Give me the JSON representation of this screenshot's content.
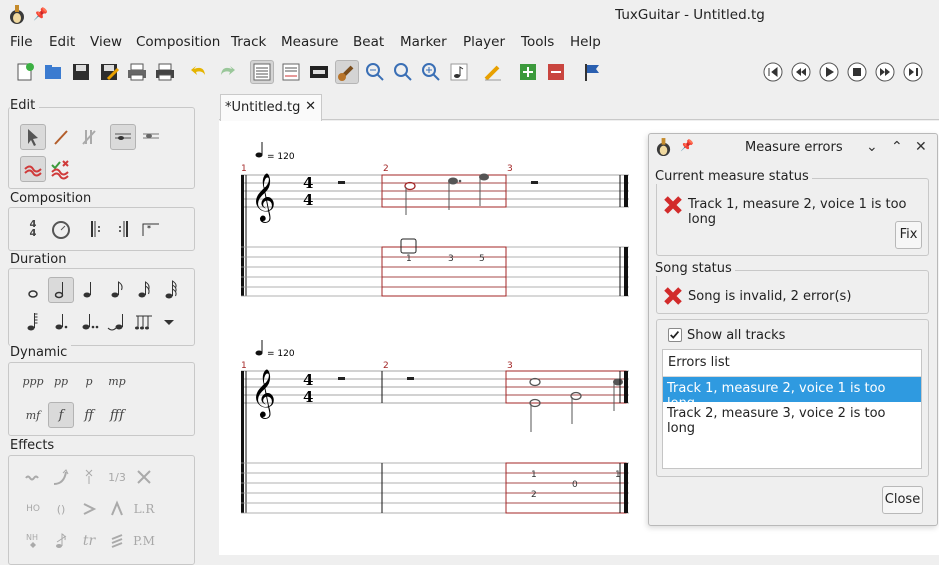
{
  "window": {
    "title": "TuxGuitar - Untitled.tg"
  },
  "menu": [
    "File",
    "Edit",
    "View",
    "Composition",
    "Track",
    "Measure",
    "Beat",
    "Marker",
    "Player",
    "Tools",
    "Help"
  ],
  "toolbar_icons": [
    "new-file-icon",
    "open-file-icon",
    "save-icon",
    "save-as-icon",
    "print-preview-icon",
    "print-icon",
    "undo-icon",
    "redo-icon",
    "score-view-icon",
    "tab-view-icon",
    "page-layout-icon",
    "guitar-fretboard-icon",
    "zoom-out-icon",
    "zoom-reset-icon",
    "zoom-in-icon",
    "note-icon",
    "edit-pencil-icon",
    "add-track-icon",
    "remove-track-icon",
    "marker-flag-icon"
  ],
  "transport_icons": [
    "first-icon",
    "previous-icon",
    "play-icon",
    "stop-icon",
    "next-icon",
    "last-icon"
  ],
  "sidebar": {
    "edit": {
      "title": "Edit"
    },
    "composition": {
      "title": "Composition"
    },
    "duration": {
      "title": "Duration"
    },
    "dynamic": {
      "title": "Dynamic",
      "items": [
        "ppp",
        "pp",
        "p",
        "mp",
        "mf",
        "f",
        "ff",
        "fff"
      ]
    },
    "effects": {
      "title": "Effects",
      "items": [
        "1/3",
        "L.R",
        "HO",
        "()",
        "tr",
        "P.M"
      ]
    }
  },
  "tab": {
    "label": "*Untitled.tg",
    "close": "✕"
  },
  "score": {
    "tempo": "= 120",
    "time_signature": "4",
    "measure_numbers": [
      "1",
      "2",
      "3"
    ],
    "track1_tab": [
      "1",
      "3",
      "5"
    ],
    "track2_tab": [
      "1",
      "2",
      "0",
      "1"
    ]
  },
  "dialog": {
    "title": "Measure errors",
    "current_status_title": "Current measure status",
    "current_status_msg": "Track 1, measure 2, voice 1 is too long",
    "fix_label": "Fix",
    "song_status_title": "Song status",
    "song_status_msg": "Song is invalid, 2 error(s)",
    "show_all_tracks": "Show all tracks",
    "errors_list_header": "Errors list",
    "errors": [
      "Track 1, measure 2, voice 1 is too long",
      "Track 2, measure 3, voice 2 is too long"
    ],
    "close_label": "Close"
  },
  "colors": {
    "selection": "#2f9ae0",
    "error_red": "#d22b2b",
    "measure_error": "#a32626"
  }
}
